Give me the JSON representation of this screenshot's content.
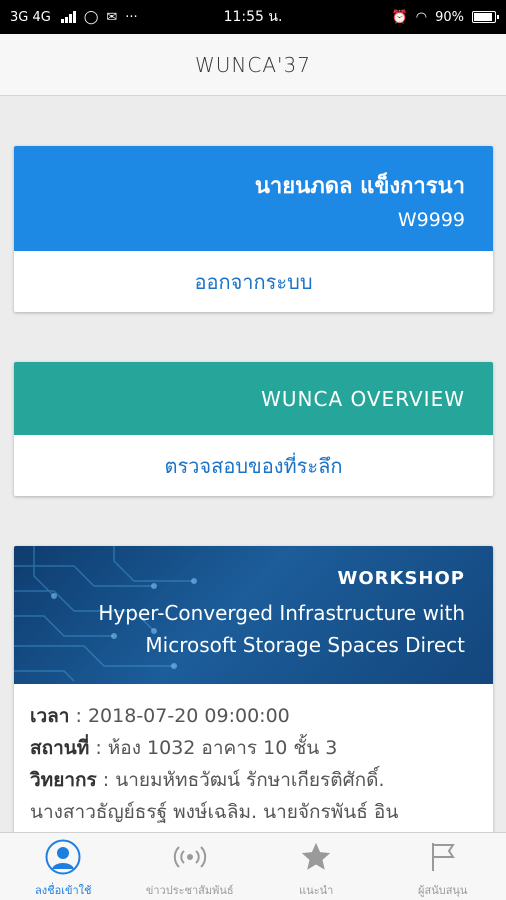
{
  "status_bar": {
    "left": "3G  4G",
    "time": "11:55 น.",
    "battery": "90%"
  },
  "app_bar": {
    "title": "WUNCA'37"
  },
  "user_card": {
    "name": "นายนภดล แข็งการนา",
    "user_id": "W9999",
    "action": "ออกจากระบบ",
    "color": "#1e88e5"
  },
  "overview_card": {
    "title": "WUNCA OVERVIEW",
    "action": "ตรวจสอบของที่ระลึก",
    "color": "#26a69a"
  },
  "workshop_card": {
    "label": "WORKSHOP",
    "subtitle_line1": "Hyper-Converged Infrastructure with",
    "subtitle_line2": "Microsoft Storage Spaces Direct",
    "time_label": "เวลา",
    "time_value": ": 2018-07-20 09:00:00",
    "place_label": "สถานที่",
    "place_value": ": ห้อง 1032 อาคาร 10 ชั้น 3",
    "speaker_label": "วิทยากร",
    "speaker_value": ": นายมหัทธวัฒน์ รักษาเกียรติศักดิ์.",
    "speaker_more": "นางสาวธัญย์ธรฐ์ พงษ์เฉลิม. นายจักรพันธ์ อิน"
  },
  "tab_bar": {
    "accent": "#1e7fe0",
    "tabs": [
      {
        "label": "ลงชื่อเข้าใช้",
        "icon": "person-icon",
        "active": true
      },
      {
        "label": "ข่าวประชาสัมพันธ์",
        "icon": "broadcast-icon",
        "active": false
      },
      {
        "label": "แนะนำ",
        "icon": "star-icon",
        "active": false
      },
      {
        "label": "ผู้สนับสนุน",
        "icon": "flag-icon",
        "active": false
      }
    ]
  }
}
